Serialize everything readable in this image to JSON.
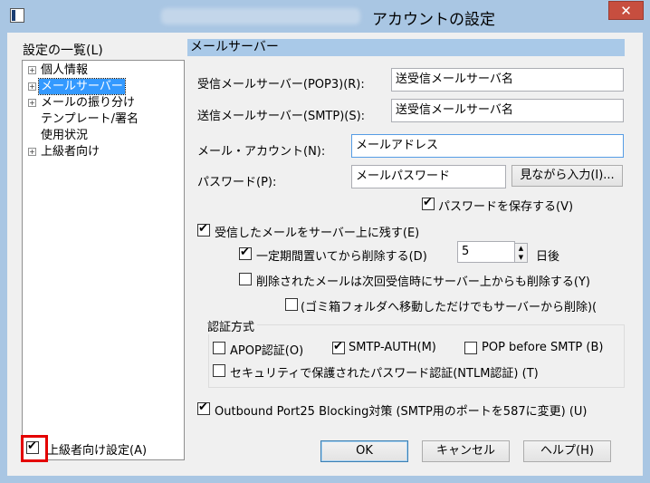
{
  "window": {
    "title": "アカウントの設定",
    "close_glyph": "✕"
  },
  "left_panel": {
    "label": "設定の一覧(L)",
    "tree": [
      {
        "label": "個人情報",
        "expander": "+"
      },
      {
        "label": "メールサーバー",
        "expander": "+",
        "selected": true
      },
      {
        "label": "メールの振り分け",
        "expander": "+"
      },
      {
        "label": "テンプレート/署名",
        "expander": ""
      },
      {
        "label": "使用状況",
        "expander": ""
      },
      {
        "label": "上級者向け",
        "expander": "+"
      }
    ],
    "advanced_checkbox": {
      "label": "上級者向け設定(A)",
      "checked": true
    }
  },
  "section": {
    "header": "メールサーバー"
  },
  "fields": {
    "pop3_label": "受信メールサーバー(POP3)(R):",
    "pop3_value": "送受信メールサーバ名",
    "smtp_label": "送信メールサーバー(SMTP)(S):",
    "smtp_value": "送受信メールサーバ名",
    "account_label": "メール・アカウント(N):",
    "account_value": "メールアドレス",
    "password_label": "パスワード(P):",
    "password_value": "メールパスワード",
    "show_password_button": "見ながら入力(I)..."
  },
  "options": {
    "save_password": {
      "label": "パスワードを保存する(V)",
      "checked": true
    },
    "leave_on_server": {
      "label": "受信したメールをサーバー上に残す(E)",
      "checked": true
    },
    "delete_after": {
      "label": "一定期間置いてから削除する(D)",
      "checked": true,
      "value": "5",
      "suffix": "日後"
    },
    "delete_when_removed": {
      "label": "削除されたメールは次回受信時にサーバー上からも削除する(Y)",
      "checked": false
    },
    "trash_move": {
      "label": "(ゴミ箱フォルダへ移動しただけでもサーバーから削除)(",
      "checked": false
    }
  },
  "auth": {
    "title": "認証方式",
    "apop": {
      "label": "APOP認証(O)",
      "checked": false
    },
    "smtp_auth": {
      "label": "SMTP-AUTH(M)",
      "checked": true
    },
    "pop_before_smtp": {
      "label": "POP before SMTP (B)",
      "checked": false
    },
    "ntlm": {
      "label": "セキュリティで保護されたパスワード認証(NTLM認証) (T)",
      "checked": false
    }
  },
  "outbound": {
    "label": "Outbound Port25 Blocking対策 (SMTP用のポートを587に変更) (U)",
    "checked": true
  },
  "buttons": {
    "ok": "OK",
    "cancel": "キャンセル",
    "help": "ヘルプ(H)"
  },
  "spin": {
    "up": "▲",
    "down": "▼"
  }
}
